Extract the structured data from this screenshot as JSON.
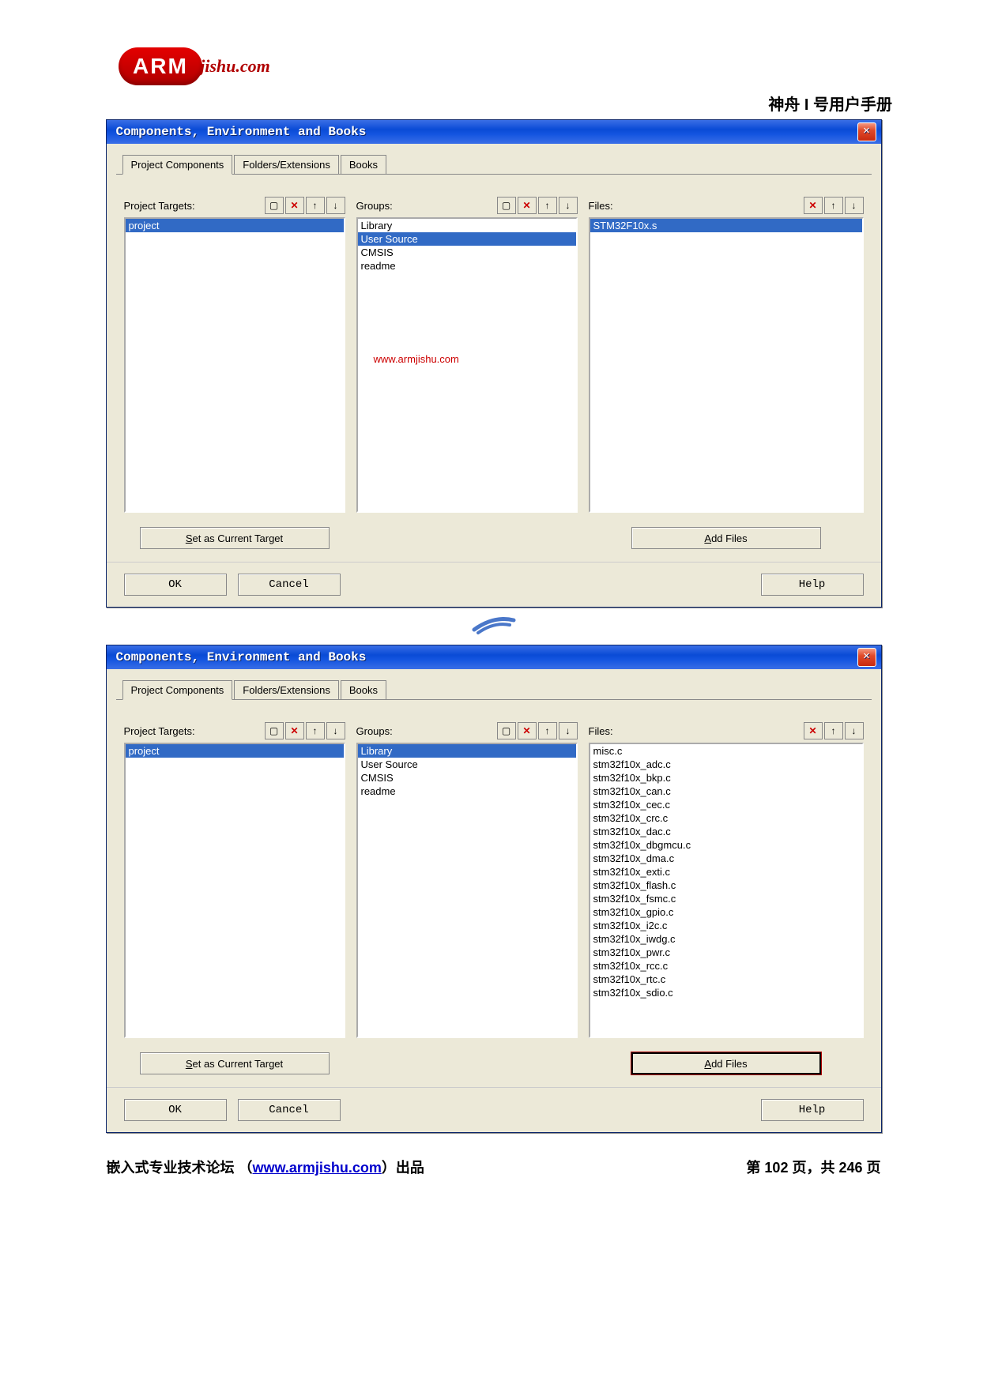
{
  "logo_main": "ARM",
  "logo_tail": "jishu.com",
  "header_title": "神舟 I 号用户手册",
  "dialog_title": "Components, Environment and Books",
  "tabs": [
    "Project Components",
    "Folders/Extensions",
    "Books"
  ],
  "columns": {
    "targets_label": "Project Targets:",
    "groups_label": "Groups:",
    "files_label": "Files:"
  },
  "toolbar_icons": [
    "new-icon",
    "delete-icon",
    "move-up-icon",
    "move-down-icon"
  ],
  "watermark": "www.armjishu.com",
  "footer_buttons": {
    "ok": "OK",
    "cancel": "Cancel",
    "help": "Help"
  },
  "col_buttons": {
    "set_target": "Set as Current Target",
    "add_files": "Add Files"
  },
  "dialog1": {
    "targets": [
      {
        "label": "project",
        "selected": true
      }
    ],
    "groups": [
      {
        "label": "Library",
        "selected": false
      },
      {
        "label": "User Source",
        "selected": true
      },
      {
        "label": "CMSIS",
        "selected": false
      },
      {
        "label": "readme",
        "selected": false
      }
    ],
    "files": [
      {
        "label": "STM32F10x.s",
        "selected": true
      }
    ]
  },
  "dialog2": {
    "targets": [
      {
        "label": "project",
        "selected": true
      }
    ],
    "groups": [
      {
        "label": "Library",
        "selected": true
      },
      {
        "label": "User Source",
        "selected": false
      },
      {
        "label": "CMSIS",
        "selected": false
      },
      {
        "label": "readme",
        "selected": false
      }
    ],
    "files": [
      {
        "label": "misc.c"
      },
      {
        "label": "stm32f10x_adc.c"
      },
      {
        "label": "stm32f10x_bkp.c"
      },
      {
        "label": "stm32f10x_can.c"
      },
      {
        "label": "stm32f10x_cec.c"
      },
      {
        "label": "stm32f10x_crc.c"
      },
      {
        "label": "stm32f10x_dac.c"
      },
      {
        "label": "stm32f10x_dbgmcu.c"
      },
      {
        "label": "stm32f10x_dma.c"
      },
      {
        "label": "stm32f10x_exti.c"
      },
      {
        "label": "stm32f10x_flash.c"
      },
      {
        "label": "stm32f10x_fsmc.c"
      },
      {
        "label": "stm32f10x_gpio.c"
      },
      {
        "label": "stm32f10x_i2c.c"
      },
      {
        "label": "stm32f10x_iwdg.c"
      },
      {
        "label": "stm32f10x_pwr.c"
      },
      {
        "label": "stm32f10x_rcc.c"
      },
      {
        "label": "stm32f10x_rtc.c"
      },
      {
        "label": "stm32f10x_sdio.c"
      }
    ]
  },
  "page_footer": {
    "left_prefix": "嵌入式专业技术论坛  （",
    "link": "www.armjishu.com",
    "left_suffix": "）出品",
    "right": "第 102 页，共 246 页"
  }
}
